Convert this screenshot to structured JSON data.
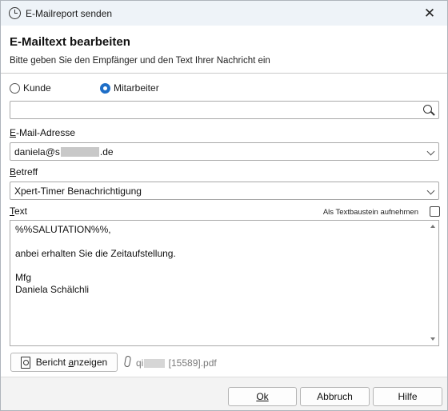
{
  "window": {
    "title": "E-Mailreport senden",
    "close_glyph": "✕",
    "icon": "clock-icon"
  },
  "header": {
    "heading": "E-Mailtext bearbeiten",
    "subheading": "Bitte geben Sie den Empfänger und den Text Ihrer Nachricht ein"
  },
  "recipient_type": {
    "options": [
      {
        "label": "Kunde",
        "selected": false
      },
      {
        "label": "Mitarbeiter",
        "selected": true
      }
    ]
  },
  "search": {
    "value": "",
    "icon": "search-icon"
  },
  "email": {
    "label_key": "E",
    "label_rest": "-Mail-Adresse",
    "value_prefix": "daniela@s",
    "value_suffix": ".de"
  },
  "subject": {
    "label_key": "B",
    "label_rest": "etreff",
    "value": "Xpert-Timer Benachrichtigung"
  },
  "text": {
    "label_key": "T",
    "label_rest": "ext",
    "checkbox_label": "Als Textbaustein aufnehmen",
    "checkbox_checked": false,
    "lines": [
      "%%SALUTATION%%,",
      "",
      "anbei erhalten Sie die Zeitaufstellung.",
      "",
      "Mfg",
      "Daniela Schälchli"
    ]
  },
  "actions": {
    "report_button_pre": "Bericht ",
    "report_button_key": "a",
    "report_button_post": "nzeigen",
    "attachment_prefix": "qi",
    "attachment_suffix": " [15589].pdf"
  },
  "footer": {
    "ok_label": "Ok",
    "cancel_label": "Abbruch",
    "help_label": "Hilfe"
  },
  "colors": {
    "accent": "#1e6ec7",
    "titlebar": "#eef3f8"
  }
}
